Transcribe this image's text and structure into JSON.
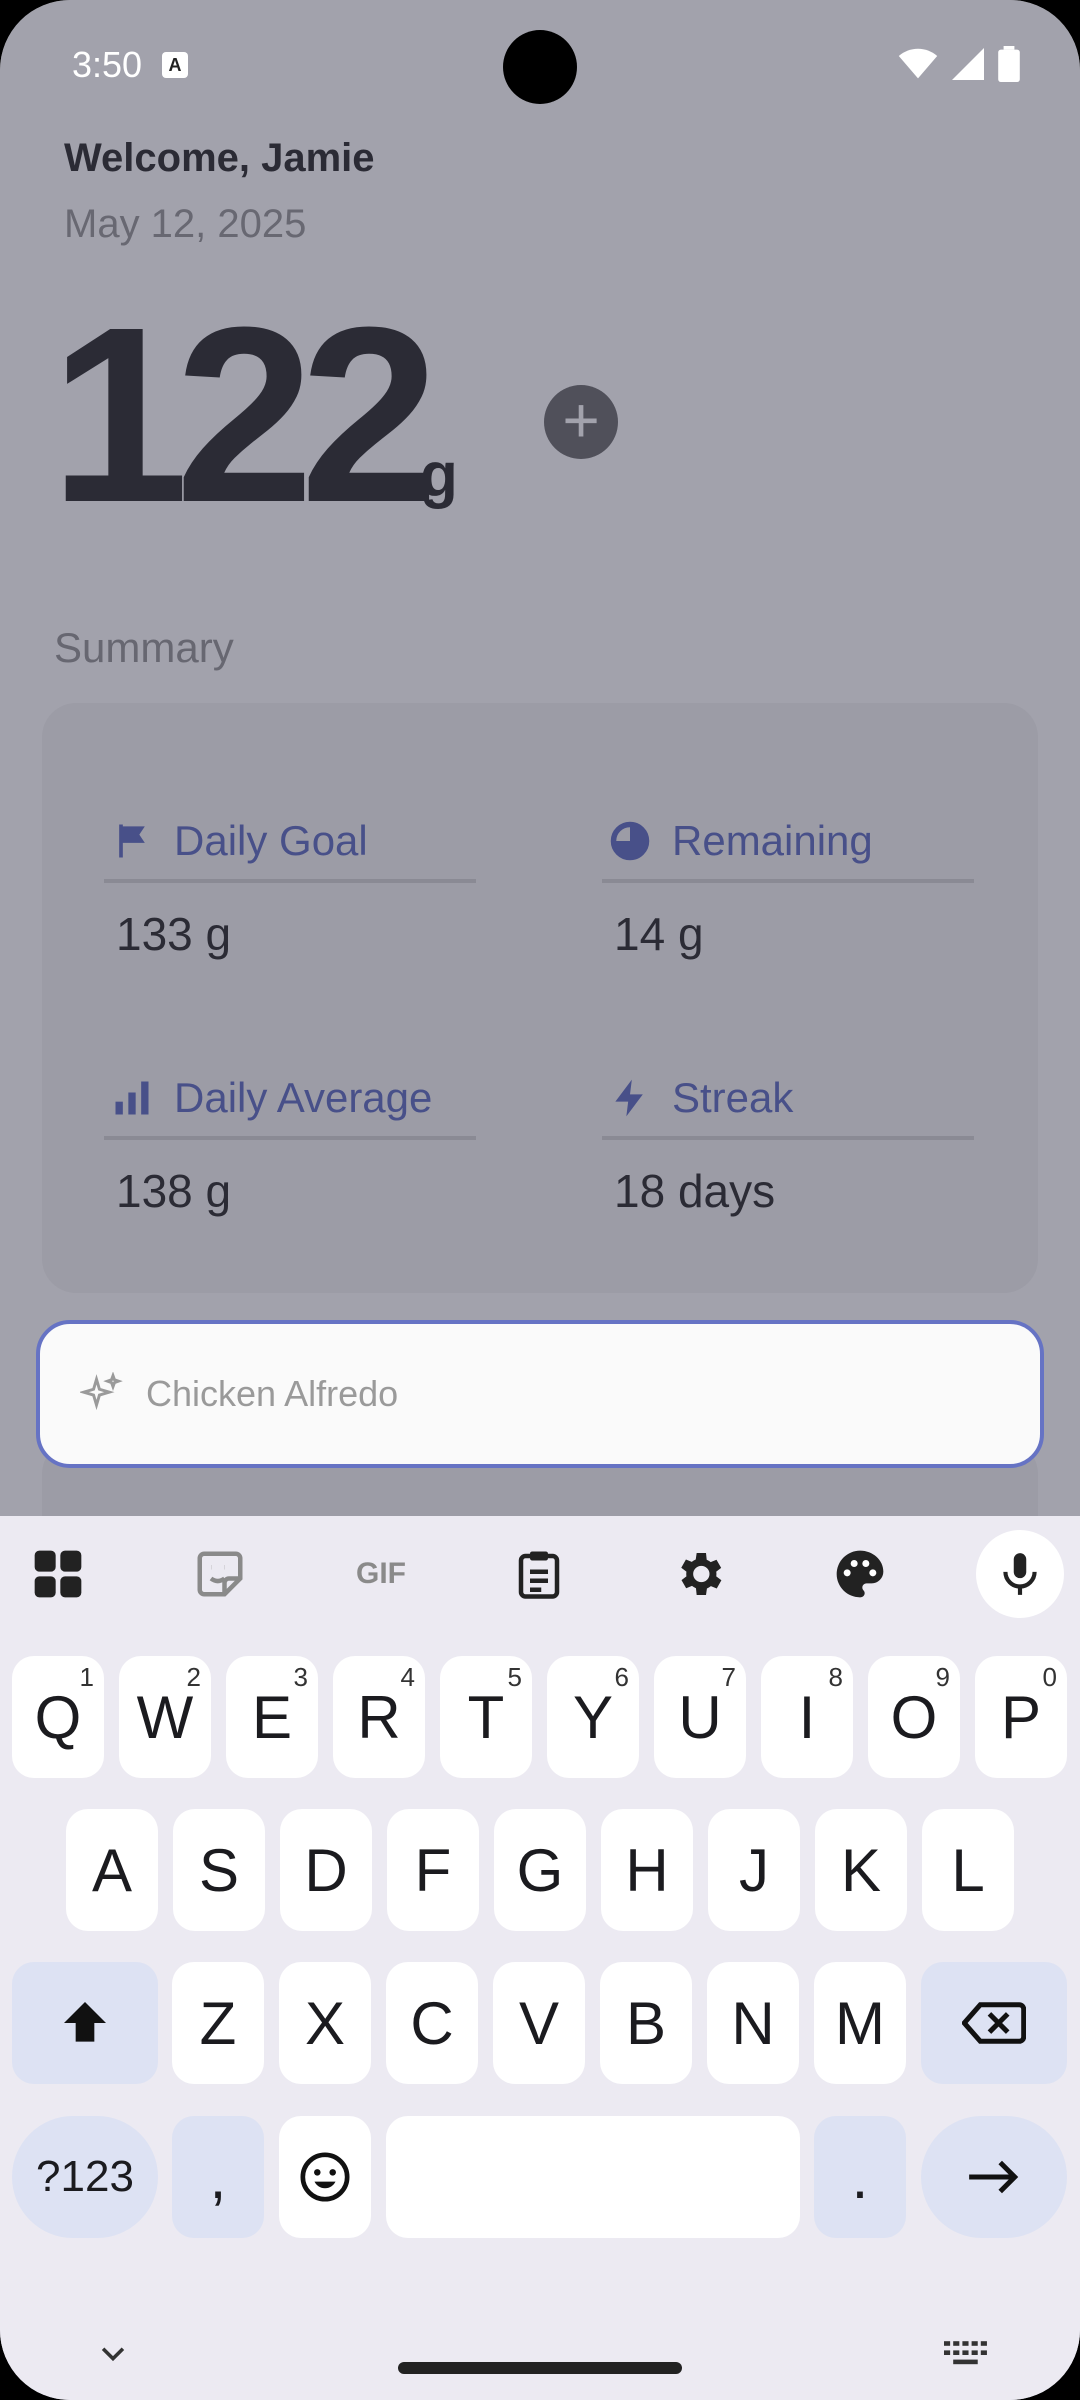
{
  "status": {
    "time": "3:50",
    "indicator": "A"
  },
  "header": {
    "welcome": "Welcome, Jamie",
    "date": "May 12, 2025"
  },
  "total": {
    "value": "122",
    "unit": "g"
  },
  "summary": {
    "title": "Summary",
    "stats": [
      {
        "label": "Daily Goal",
        "value": "133 g",
        "icon": "flag-icon"
      },
      {
        "label": "Remaining",
        "value": "14 g",
        "icon": "pie-progress-icon"
      },
      {
        "label": "Daily Average",
        "value": "138 g",
        "icon": "bar-chart-icon"
      },
      {
        "label": "Streak",
        "value": "18 days",
        "icon": "bolt-icon"
      }
    ]
  },
  "search": {
    "placeholder": "Chicken Alfredo"
  },
  "keyboard": {
    "row1": [
      "Q",
      "W",
      "E",
      "R",
      "T",
      "Y",
      "U",
      "I",
      "O",
      "P"
    ],
    "row1_hints": [
      "1",
      "2",
      "3",
      "4",
      "5",
      "6",
      "7",
      "8",
      "9",
      "0"
    ],
    "row2": [
      "A",
      "S",
      "D",
      "F",
      "G",
      "H",
      "J",
      "K",
      "L"
    ],
    "row3": [
      "Z",
      "X",
      "C",
      "V",
      "B",
      "N",
      "M"
    ],
    "symbols": "?123",
    "comma": ",",
    "period": "."
  },
  "colors": {
    "accent": "#4a5bb8",
    "keyboard_bg": "#eceaf2",
    "mod_key": "#dde2f3"
  }
}
